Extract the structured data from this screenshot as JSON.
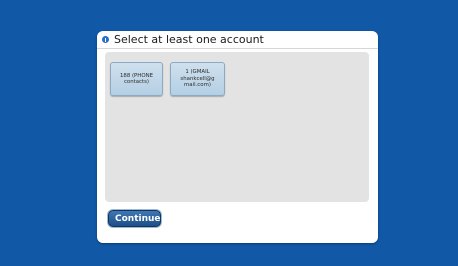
{
  "dialog": {
    "title": "Select at least one account",
    "icon": "info-icon"
  },
  "accounts": [
    {
      "label": "188 (PHONE\ncontacts)"
    },
    {
      "label": "1 (GMAIL\nshankcell@g\nmail.com)"
    }
  ],
  "actions": {
    "continue_label": "Continue"
  },
  "colors": {
    "background": "#1158a7",
    "panel": "#e3e3e3",
    "tile": "#c3d8ea",
    "button": "#2d6198"
  }
}
